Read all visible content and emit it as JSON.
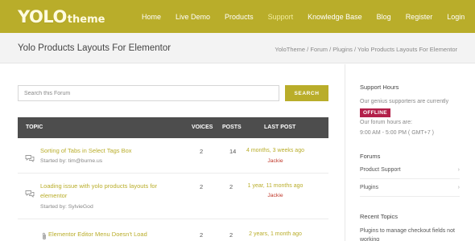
{
  "header": {
    "logo_main": "YOLO",
    "logo_sub": "theme",
    "nav": [
      "Home",
      "Live Demo",
      "Products",
      "Support",
      "Knowledge Base",
      "Blog",
      "Register",
      "Login"
    ],
    "active_nav": "Support",
    "search_icon": "search-icon",
    "brand_color": "#b9ad2a"
  },
  "titlebar": {
    "title": "Yolo Products Layouts For Elementor",
    "breadcrumb": [
      "YoloTheme",
      "Forum",
      "Plugins",
      "Yolo Products Layouts For Elementor"
    ],
    "breadcrumb_sep": " / "
  },
  "forum": {
    "search_placeholder": "Search this Forum",
    "search_button": "SEARCH",
    "columns": {
      "topic": "TOPIC",
      "voices": "VOICES",
      "posts": "POSTS",
      "last_post": "LAST POST"
    },
    "topics": [
      {
        "icon": "forum-chat-icon",
        "title": "Sorting of Tabs in Select Tags Box",
        "started_by": "Started by: tim@burne.us",
        "voices": "2",
        "posts": "14",
        "freshness": "4 months, 3 weeks ago",
        "author": "Jackie"
      },
      {
        "icon": "forum-chat-icon",
        "title": "Loading issue with yolo products layouts for elementor",
        "started_by": "Started by: SylvieGod",
        "voices": "2",
        "posts": "2",
        "freshness": "1 year, 11 months ago",
        "author": "Jackie"
      },
      {
        "icon": "attachment-icon",
        "title": "Elementor Editor Menu Doesn't Load",
        "started_by": "",
        "voices": "2",
        "posts": "2",
        "freshness": "2 years, 1 month ago",
        "author": ""
      }
    ]
  },
  "sidebar": {
    "support_hours_title": "Support Hours",
    "supporters_text": "Our genius supporters are currently",
    "status_badge": "OFFLINE",
    "status_color": "#b3204a",
    "hours_label": "Our forum hours are:",
    "hours_value": "9:00 AM - 5:00 PM ( GMT+7 )",
    "forums_title": "Forums",
    "forums": [
      "Product Support",
      "Plugins"
    ],
    "recent_title": "Recent Topics",
    "recent_topics": [
      "Plugins to manage checkout fields not working"
    ]
  }
}
